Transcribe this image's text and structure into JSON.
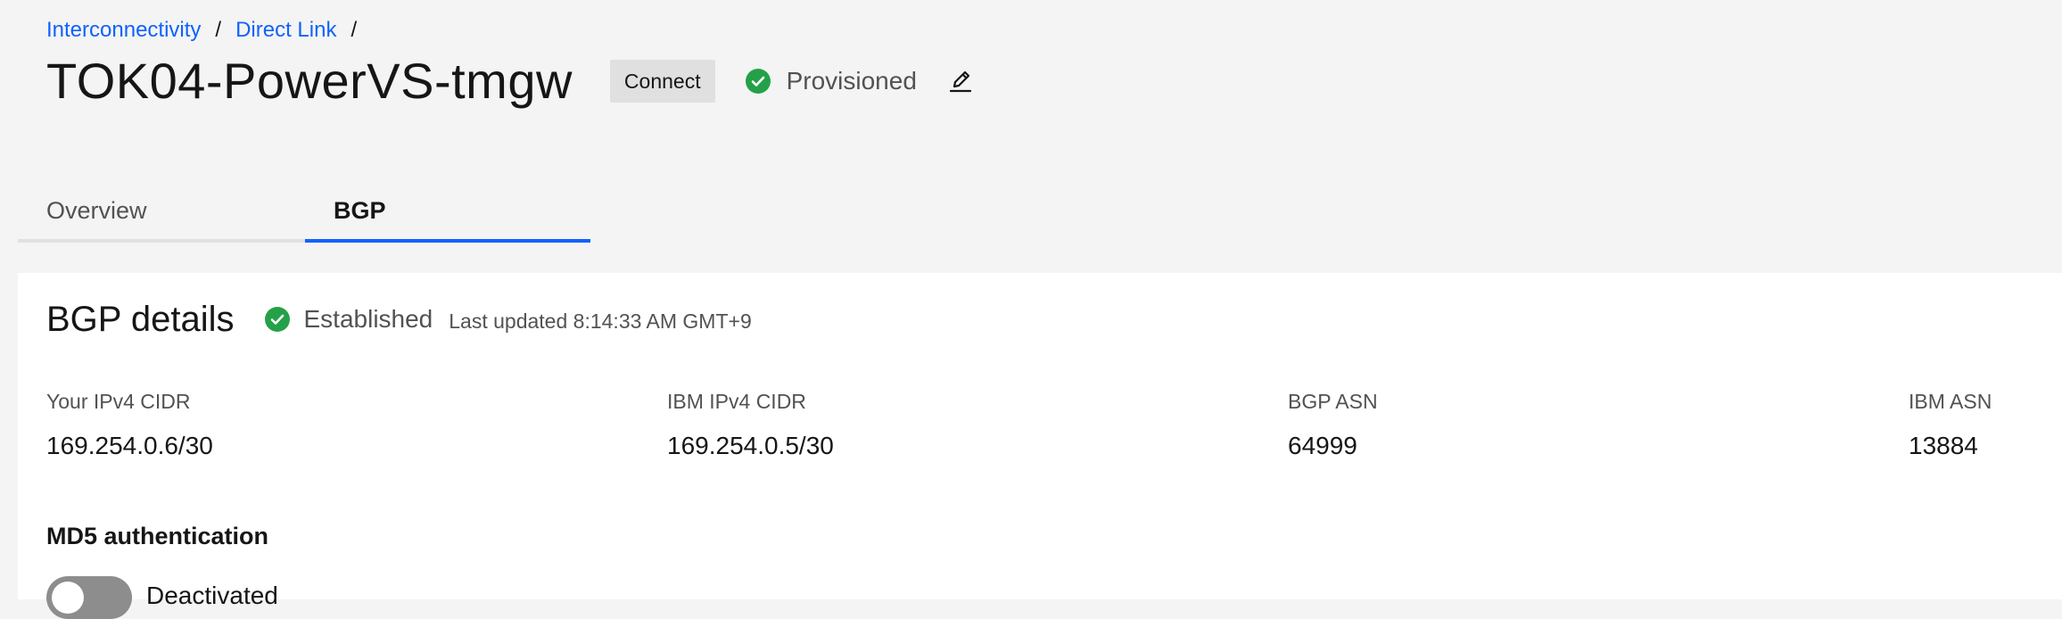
{
  "breadcrumb": {
    "items": [
      {
        "label": "Interconnectivity"
      },
      {
        "label": "Direct Link"
      }
    ],
    "separator": "/"
  },
  "header": {
    "title": "TOK04-PowerVS-tmgw",
    "tag": "Connect",
    "status": "Provisioned",
    "status_color": "#24a148",
    "edit_icon": "edit-icon"
  },
  "tabs": [
    {
      "label": "Overview",
      "active": false
    },
    {
      "label": "BGP",
      "active": true
    }
  ],
  "bgp": {
    "title": "BGP details",
    "status": "Established",
    "last_updated": "Last updated 8:14:33 AM GMT+9",
    "fields": [
      {
        "label": "Your IPv4 CIDR",
        "value": "169.254.0.6/30"
      },
      {
        "label": "IBM IPv4 CIDR",
        "value": "169.254.0.5/30"
      },
      {
        "label": "BGP ASN",
        "value": "64999"
      },
      {
        "label": "IBM ASN",
        "value": "13884"
      }
    ],
    "md5": {
      "label": "MD5 authentication",
      "toggle_state": "Deactivated"
    }
  },
  "colors": {
    "link": "#0f62fe",
    "success": "#24a148",
    "background": "#f4f4f4",
    "tile": "#ffffff"
  }
}
